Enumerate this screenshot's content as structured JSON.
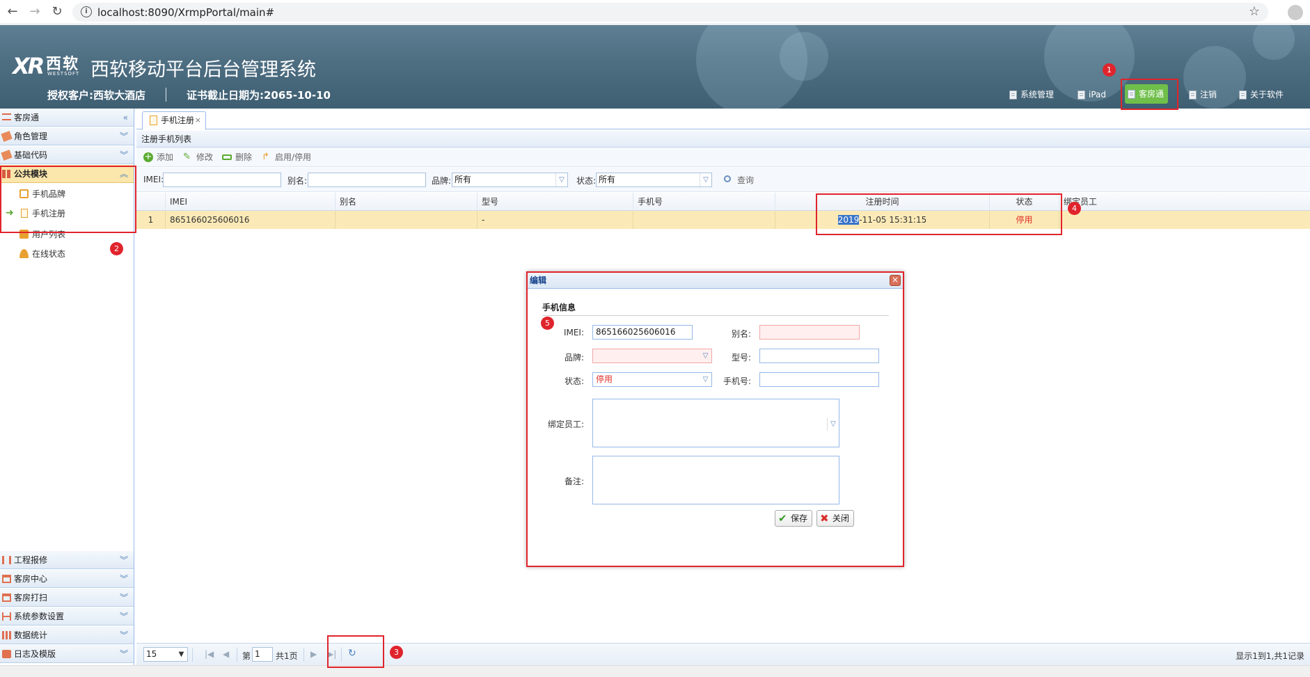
{
  "browser": {
    "url": "localhost:8090/XrmpPortal/main#"
  },
  "header": {
    "logo_mark": "XR",
    "logo_cn": "西软",
    "logo_en": "WESTSOFT",
    "system_title": "西软移动平台后台管理系统",
    "customer": "授权客户:西软大酒店",
    "cert_date": "证书截止日期为:2065-10-10",
    "buttons": [
      "系统管理",
      "iPad",
      "客房通",
      "注销",
      "关于软件"
    ]
  },
  "sidebar": {
    "top_sections": [
      "客房通",
      "角色管理",
      "基础代码",
      "公共模块"
    ],
    "sub_items": [
      "手机品牌",
      "手机注册",
      "用户列表",
      "在线状态"
    ],
    "bottom_sections": [
      "工程报修",
      "客房中心",
      "客房打扫",
      "系统参数设置",
      "数据统计",
      "日志及模版"
    ]
  },
  "main": {
    "tab_label": "手机注册",
    "tab_close": "×",
    "panel_title": "注册手机列表",
    "toolbar": [
      "添加",
      "修改",
      "删除",
      "启用/停用"
    ],
    "search": {
      "imei_label": "IMEI:",
      "alias_label": "别名:",
      "brand_label": "品牌:",
      "brand_value": "所有",
      "status_label": "状态:",
      "status_value": "所有",
      "query_label": "查询"
    },
    "grid": {
      "columns": [
        "IMEI",
        "别名",
        "型号",
        "手机号",
        "注册时间",
        "状态",
        "绑定员工"
      ],
      "row": {
        "num": "1",
        "imei": "865166025606016",
        "alias": "",
        "model": "-",
        "phone": "",
        "reg_time_highlight": "2019",
        "reg_time_rest": "-11-05 15:31:15",
        "status": "停用"
      }
    },
    "pager": {
      "page_size": "15",
      "page_prefix": "第",
      "page_value": "1",
      "page_total": "共1页",
      "summary": "显示1到1,共1记录"
    }
  },
  "dialog": {
    "title": "编辑",
    "close": "×",
    "fieldset_title": "手机信息",
    "imei_label": "IMEI:",
    "imei_value": "865166025606016",
    "alias_label": "别名:",
    "brand_label": "品牌:",
    "model_label": "型号:",
    "status_label": "状态:",
    "status_value": "停用",
    "phone_label": "手机号:",
    "employee_label": "绑定员工:",
    "remark_label": "备注:",
    "save_label": "保存",
    "close_label": "关闭"
  },
  "annotations": [
    "1",
    "2",
    "3",
    "4",
    "5"
  ]
}
